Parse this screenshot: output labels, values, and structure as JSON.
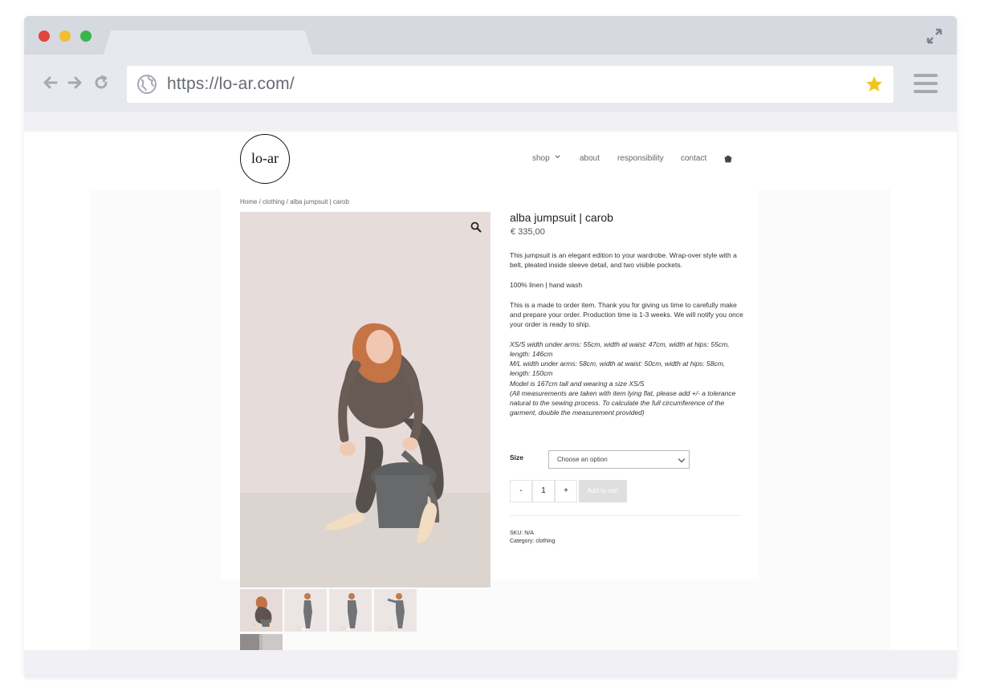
{
  "browser": {
    "url": "https://lo-ar.com/",
    "icons": {
      "close": "red-dot",
      "minimize": "yellow-dot",
      "maximize": "green-dot",
      "expand": "expand-icon",
      "back": "back-icon",
      "forward": "forward-icon",
      "reload": "reload-icon",
      "globe": "globe-icon",
      "star": "star-icon",
      "menu": "menu-icon"
    },
    "colors": {
      "accent_star": "#f2c51c",
      "tab_bar": "#d7d9e1",
      "nav_bar": "#e7e9ee"
    }
  },
  "site": {
    "logo": "lo-ar",
    "nav": {
      "items": [
        "shop",
        "about",
        "responsibility",
        "contact"
      ],
      "shop_dropdown_icon": "chevron-down-icon",
      "cart_icon": "cart-icon"
    }
  },
  "breadcrumb": "Home / clothing / alba jumpsuit | carob",
  "product": {
    "title": "alba jumpsuit | carob",
    "price": "€ 335,00",
    "description": [
      "This jumpsuit is an elegant edition to your wardrobe. Wrap-over style with a belt, pleated inside sleeve detail, and two visible pockets.",
      "100% linen | hand wash",
      "This is a made to order item. Thank you for giving us time to carefully make and prepare your order. Production time is 1-3 weeks. We will notify you once your order is ready to ship."
    ],
    "measurements": [
      "XS/S width under arms: 55cm, width at waist: 47cm, width at hips: 55cm, length: 146cm",
      "M/L width under arms: 58cm, width at waist: 50cm, width at hips: 58cm, length: 150cm",
      "Model is 167cm tall and wearing a size XS/S",
      "(All measurements are taken with item lying flat, please add +/- a tolerance natural to the sewing process. To calculate the full circumference of the garment, double the measurement provided)"
    ],
    "size": {
      "label": "Size",
      "placeholder": "Choose an option"
    },
    "quantity": {
      "minus": "-",
      "value": "1",
      "plus": "+"
    },
    "add_to_cart": "Add to cart",
    "sku_label": "SKU:",
    "sku_value": "N/A",
    "category_label": "Category:",
    "category_value": "clothing",
    "image": {
      "zoom_icon": "zoom-icon",
      "thumbnail_count": 5
    }
  }
}
